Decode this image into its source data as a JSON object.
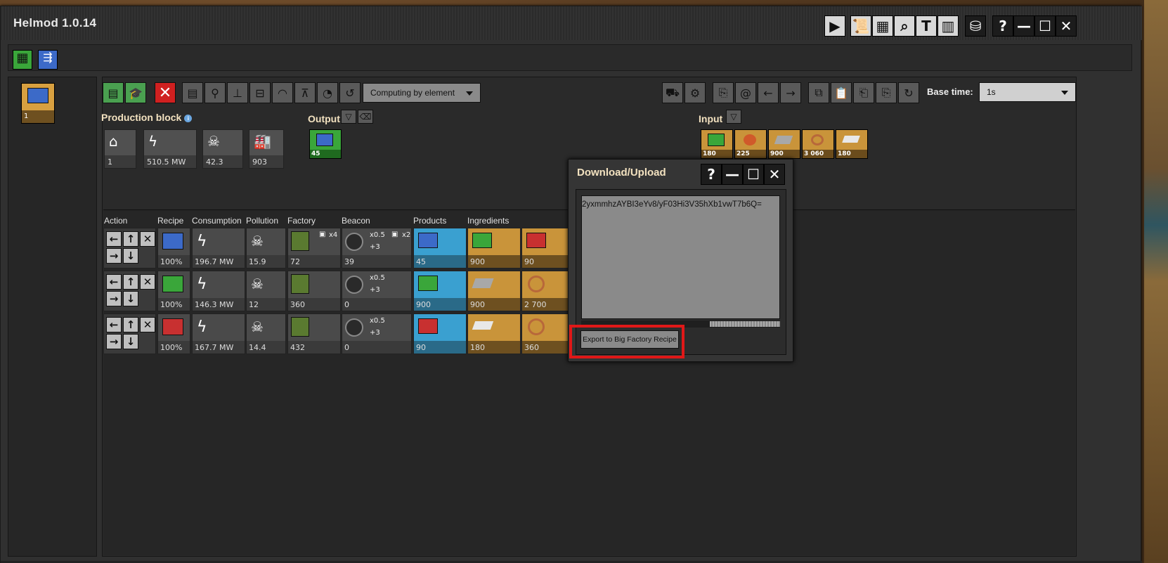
{
  "app": {
    "title": "Helmod 1.0.14"
  },
  "title_buttons": [
    "play-icon",
    "scroll-icon",
    "calculator-icon",
    "search-icon",
    "text-icon",
    "chart-icon",
    "data-icon",
    "help-icon",
    "minimize-icon",
    "maximize-icon",
    "close-icon"
  ],
  "model": {
    "count": "1"
  },
  "toolbar": {
    "computing_label": "Computing by element",
    "base_time_label": "Base time:",
    "base_time_value": "1s"
  },
  "production_block": {
    "title": "Production block",
    "stats": [
      {
        "icon": "factory-building-icon",
        "value": "1"
      },
      {
        "icon": "lightning-icon",
        "value": "510.5 MW"
      },
      {
        "icon": "skull-icon",
        "value": "42.3"
      },
      {
        "icon": "factory-icon",
        "value": "903"
      }
    ]
  },
  "output": {
    "title": "Output",
    "items": [
      {
        "icon": "advanced-circuit-icon",
        "value": "45"
      }
    ]
  },
  "input": {
    "title": "Input",
    "items": [
      {
        "icon": "electronic-circuit-icon",
        "value": "180"
      },
      {
        "icon": "plastic-icon",
        "value": "225"
      },
      {
        "icon": "iron-plate-icon",
        "value": "900"
      },
      {
        "icon": "copper-cable-icon",
        "value": "3 060"
      },
      {
        "icon": "steel-icon",
        "value": "180"
      }
    ]
  },
  "table": {
    "headers": [
      "Action",
      "Recipe",
      "Consumption",
      "Pollution",
      "Factory",
      "Beacon",
      "Products",
      "Ingredients"
    ],
    "rows": [
      {
        "recipe_pct": "100%",
        "consumption": "196.7 MW",
        "pollution": "15.9",
        "factory": "72",
        "factory_mod": "x4",
        "beacon": "39",
        "beacon_x": "x0.5",
        "beacon_plus": "+3",
        "beacon_mod": "x2",
        "product": "45",
        "ing1": "900",
        "ing2": "90"
      },
      {
        "recipe_pct": "100%",
        "consumption": "146.3 MW",
        "pollution": "12",
        "factory": "360",
        "factory_mod": "",
        "beacon": "0",
        "beacon_x": "x0.5",
        "beacon_plus": "+3",
        "beacon_mod": "",
        "product": "900",
        "ing1": "900",
        "ing2": "2 700"
      },
      {
        "recipe_pct": "100%",
        "consumption": "167.7 MW",
        "pollution": "14.4",
        "factory": "432",
        "factory_mod": "",
        "beacon": "0",
        "beacon_x": "x0.5",
        "beacon_plus": "+3",
        "beacon_mod": "",
        "product": "90",
        "ing1": "180",
        "ing2": "360"
      }
    ]
  },
  "dialog": {
    "title": "Download/Upload",
    "text": "2yxmmhzAYBI3eYv8/yF03Hi3V35hXb1vwT7b6Q=",
    "export_label": "Export to Big Factory Recipe"
  },
  "colors": {
    "highlight": "#e01818",
    "green": "#4aa050",
    "gold": "#c9943a",
    "blue": "#3aa0d0"
  }
}
